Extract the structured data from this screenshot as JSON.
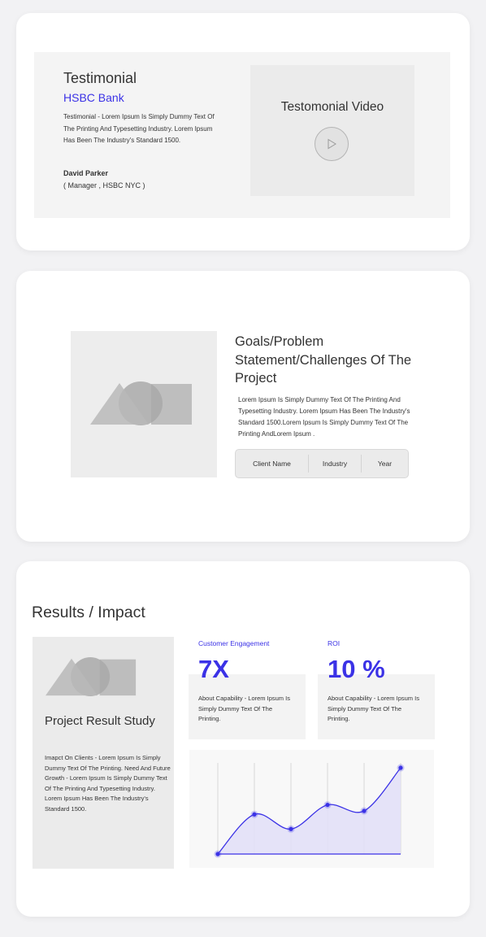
{
  "testimonial": {
    "title": "Testimonial",
    "company": "HSBC Bank",
    "body": "Testimonial - Lorem Ipsum Is Simply Dummy Text Of The Printing And Typesetting Industry. Lorem Ipsum Has Been The Industry's Standard 1500.",
    "author": "David Parker",
    "role": "( Manager , HSBC NYC )",
    "video_title": "Testomonial Video",
    "play_icon": "play-icon"
  },
  "goals": {
    "title": "Goals/Problem Statement/Challenges Of The Project",
    "body": "Lorem Ipsum Is Simply Dummy Text Of The Printing And Typesetting Industry. Lorem Ipsum Has Been The Industry's Standard 1500.Lorem Ipsum Is Simply Dummy Text Of The Printing AndLorem Ipsum .",
    "info": [
      "Client  Name",
      "Industry",
      "Year"
    ]
  },
  "results": {
    "title": "Results / Impact",
    "study_title": "Project Result Study",
    "study_body": "Imapct On Clients - Lorem Ipsum Is Simply Dummy Text Of The Printing. Need And Future Growth - Lorem Ipsum Is Simply Dummy Text Of The Printing And Typesetting Industry. Lorem Ipsum Has Been The Industry's Standard 1500.",
    "stats": [
      {
        "label": "Customer Engagement",
        "value": "7X",
        "desc": "About Capability - Lorem Ipsum Is Simply Dummy Text Of The Printing."
      },
      {
        "label": "ROI",
        "value": "10 %",
        "desc": "About Capability - Lorem Ipsum Is Simply Dummy Text Of The Printing."
      }
    ]
  },
  "colors": {
    "accent": "#3b32e6",
    "chart_fill": "#e2e0f7",
    "placeholder_shape": "#b5b5b5"
  },
  "chart_data": {
    "type": "area",
    "x": [
      0,
      1,
      2,
      3,
      4,
      5
    ],
    "values": [
      0,
      46,
      29,
      57,
      50,
      100
    ],
    "ylim": [
      0,
      100
    ],
    "grid": true,
    "title": "",
    "xlabel": "",
    "ylabel": ""
  }
}
